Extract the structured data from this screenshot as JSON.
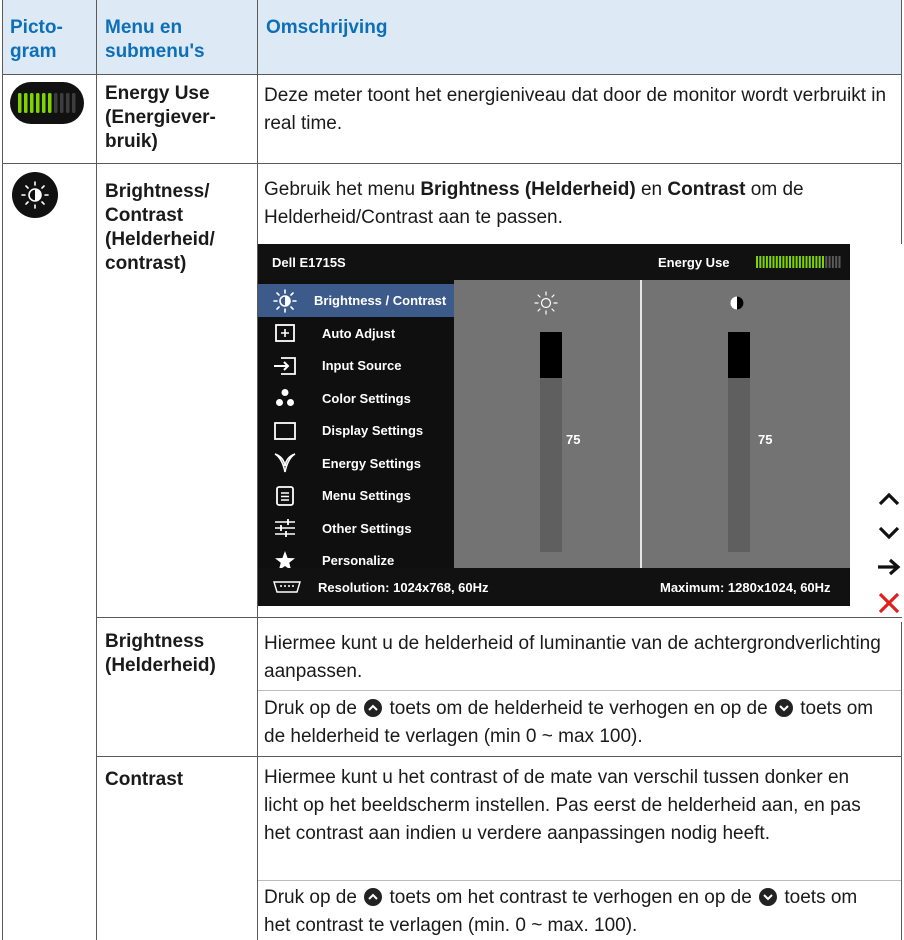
{
  "header": {
    "col1": [
      "Picto-",
      "gram"
    ],
    "col2": [
      "Menu en",
      "submenu's"
    ],
    "col3": "Omschrijving"
  },
  "rows": {
    "energy": {
      "label": [
        "Energy Use",
        "(Energiever-",
        "bruik)"
      ],
      "description": "Deze meter toont het energieniveau dat door de monitor wordt verbruikt in real time.",
      "icon": "energy-meter-icon"
    },
    "brightness_contrast": {
      "label": [
        "Brightness/",
        "Contrast",
        "(Helderheid/",
        "contrast)"
      ],
      "desc_pre": "Gebruik het menu ",
      "desc_b1": "Brightness (Helderheid)",
      "desc_mid": " en ",
      "desc_b2": "Contrast",
      "desc_post": " om de Helderheid/Contrast aan te passen.",
      "icon": "brightness-contrast-icon"
    },
    "brightness": {
      "label": [
        "Brightness",
        "(Helderheid)"
      ],
      "desc1": "Hiermee kunt u de helderheid of luminantie van de achtergrondverlichting aanpassen.",
      "desc2_a": "Druk op de ",
      "desc2_b": " toets om de helderheid te verhogen en op de ",
      "desc2_c": " toets om de helderheid te verlagen (min 0 ~ max 100)."
    },
    "contrast": {
      "label": "Contrast",
      "desc1": "Hiermee kunt u het contrast of de mate van verschil tussen donker en licht op het beeldscherm instellen. Pas eerst de helderheid aan, en pas het contrast aan indien u verdere aanpassingen nodig heeft.",
      "desc2_a": "Druk op de ",
      "desc2_b": " toets om het contrast te verhogen en op de ",
      "desc2_c": " toets om het contrast te verlagen (min. 0 ~ max. 100)."
    }
  },
  "osd": {
    "model": "Dell E1715S",
    "energy_label": "Energy Use",
    "energy_level": 0.8,
    "menu": [
      {
        "label": "Brightness / Contrast",
        "icon": "sun-icon",
        "selected": true
      },
      {
        "label": "Auto Adjust",
        "icon": "auto-adjust-icon",
        "selected": false
      },
      {
        "label": "Input Source",
        "icon": "input-source-icon",
        "selected": false
      },
      {
        "label": "Color Settings",
        "icon": "color-dots-icon",
        "selected": false
      },
      {
        "label": "Display Settings",
        "icon": "display-square-icon",
        "selected": false
      },
      {
        "label": "Energy Settings",
        "icon": "leaf-icon",
        "selected": false
      },
      {
        "label": "Menu Settings",
        "icon": "menu-doc-icon",
        "selected": false
      },
      {
        "label": "Other Settings",
        "icon": "sliders-icon",
        "selected": false
      },
      {
        "label": "Personalize",
        "icon": "star-icon",
        "selected": false
      }
    ],
    "brightness_value": "75",
    "contrast_value": "75",
    "brightness_level": 0.75,
    "contrast_level": 0.75,
    "resolution": "Resolution: 1024x768, 60Hz",
    "maximum": "Maximum: 1280x1024, 60Hz"
  },
  "nav_buttons": [
    "up-arrow-icon",
    "down-arrow-icon",
    "right-arrow-icon",
    "close-x-icon"
  ],
  "colors": {
    "header_bg": "#dde9f5",
    "header_text": "#0c6fb8",
    "osd_selected": "#3c5a8a",
    "meter_green": "#7fd400",
    "close_red": "#e0201c"
  }
}
